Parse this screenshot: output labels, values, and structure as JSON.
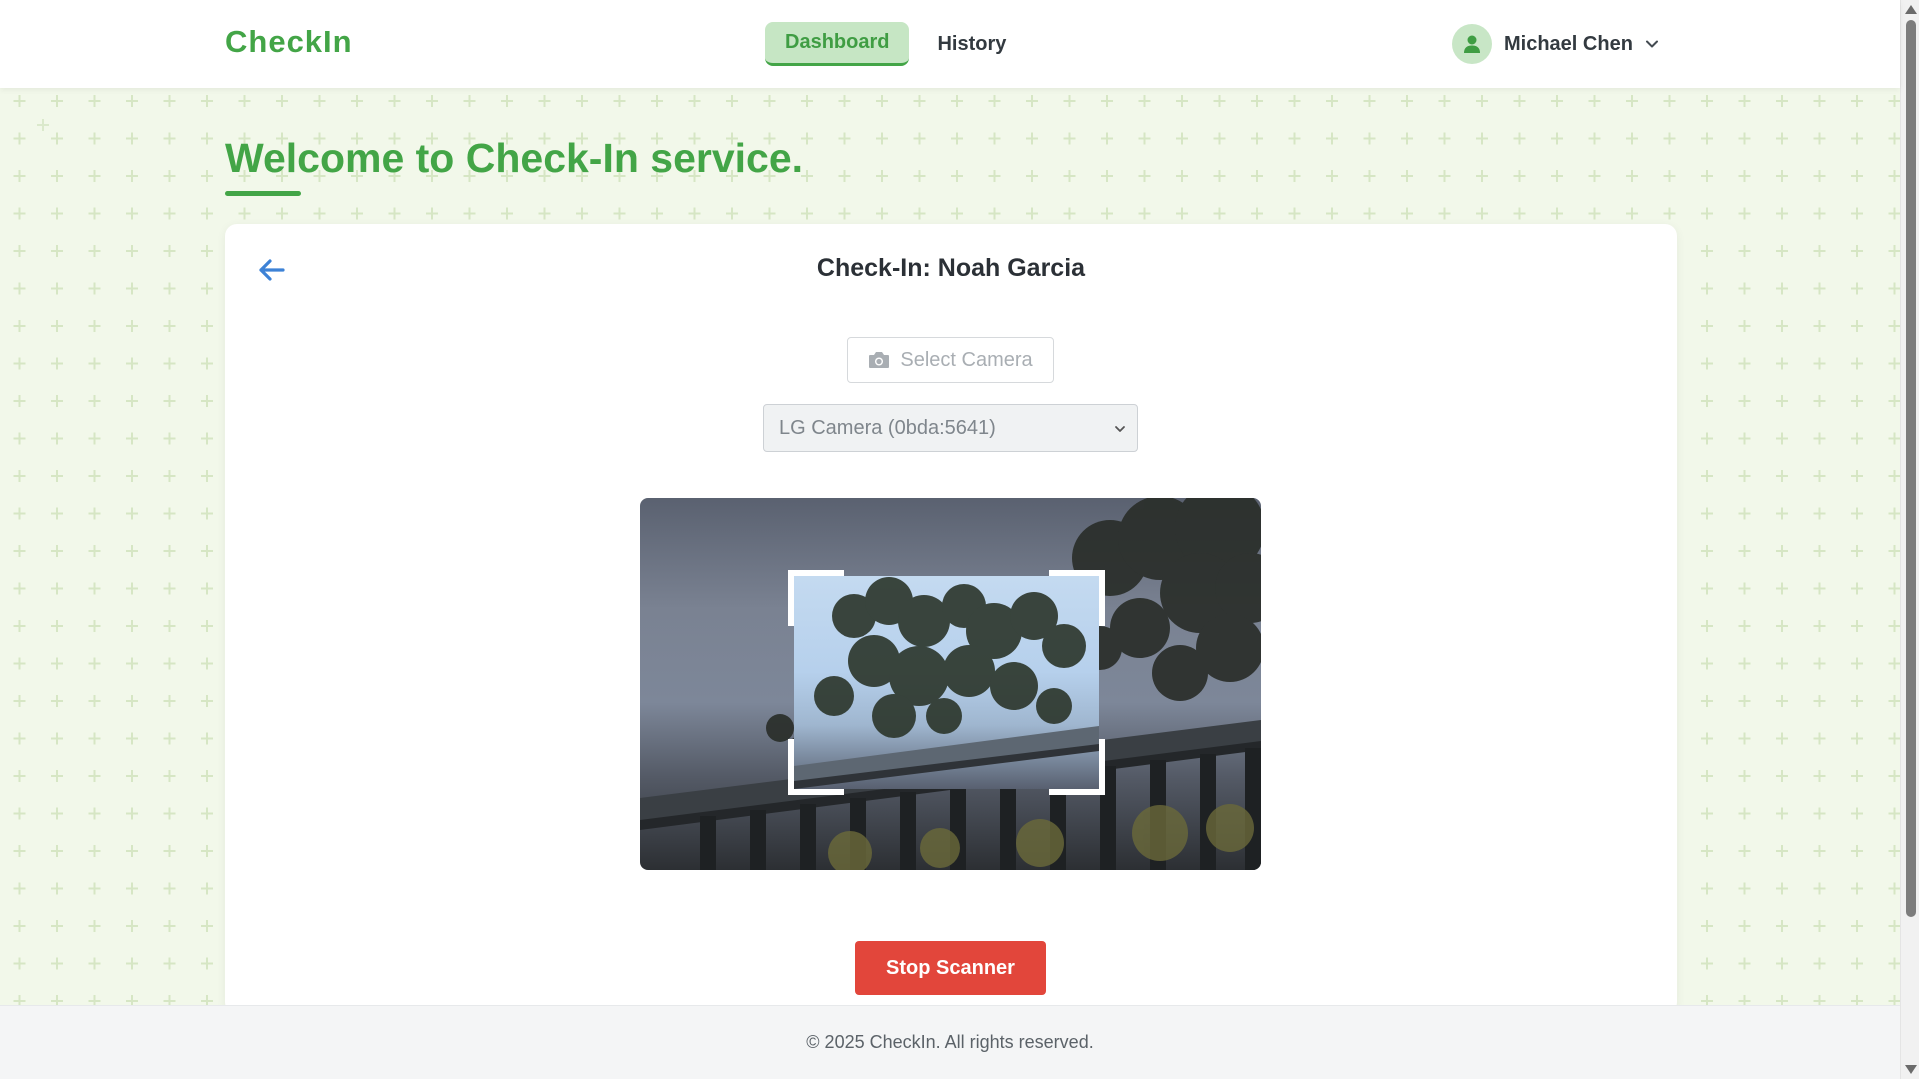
{
  "app": {
    "logo": "CheckIn"
  },
  "nav": {
    "items": [
      {
        "label": "Dashboard",
        "active": true
      },
      {
        "label": "History",
        "active": false
      }
    ]
  },
  "user": {
    "name": "Michael Chen",
    "avatar_icon": "user-icon",
    "menu_icon": "chevron-down-icon"
  },
  "page": {
    "title": "Welcome to Check-In service."
  },
  "card": {
    "title": "Check-In: Noah Garcia",
    "back_icon": "arrow-left-icon",
    "select_camera_label": "Select Camera",
    "camera_icon": "camera-icon",
    "camera_selected": "LG Camera (0bda:5641)",
    "stop_button_label": "Stop Scanner"
  },
  "footer": {
    "text": "© 2025 CheckIn. All rights reserved."
  },
  "colors": {
    "brand": "#43a547",
    "nav_active_bg": "#c6e6c4",
    "danger": "#e2463b",
    "back_arrow": "#3d82d6"
  }
}
